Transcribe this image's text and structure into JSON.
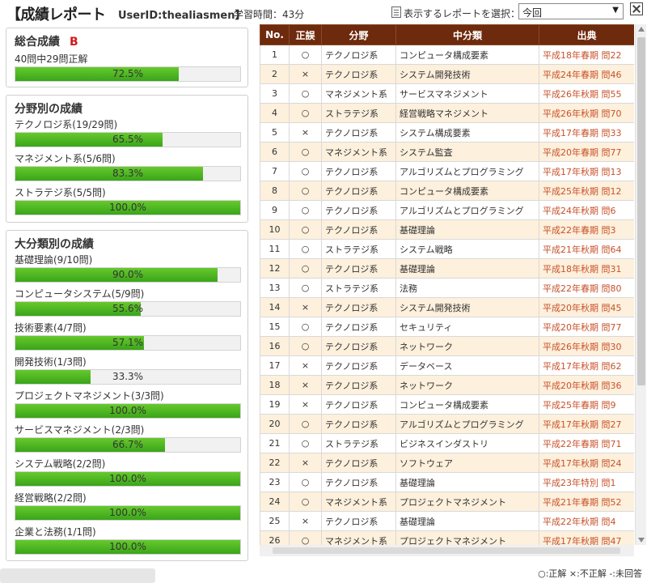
{
  "header": {
    "title": "【成績レポート",
    "userid": "UserID:thealiasmen】",
    "study_time": "学習時間：43分",
    "select_label": "表示するレポートを選択：",
    "select_value": "今回"
  },
  "overall": {
    "title": "総合成績",
    "grade": "B",
    "summary": "40問中29問正解",
    "pct_text": "72.5%",
    "pct": 72.5
  },
  "field": {
    "title": "分野別の成績",
    "items": [
      {
        "label": "テクノロジ系(19/29問)",
        "pct_text": "65.5%",
        "pct": 65.5
      },
      {
        "label": "マネジメント系(5/6問)",
        "pct_text": "83.3%",
        "pct": 83.3
      },
      {
        "label": "ストラテジ系(5/5問)",
        "pct_text": "100.0%",
        "pct": 100
      }
    ]
  },
  "category": {
    "title": "大分類別の成績",
    "items": [
      {
        "label": "基礎理論(9/10問)",
        "pct_text": "90.0%",
        "pct": 90
      },
      {
        "label": "コンピュータシステム(5/9問)",
        "pct_text": "55.6%",
        "pct": 55.6
      },
      {
        "label": "技術要素(4/7問)",
        "pct_text": "57.1%",
        "pct": 57.1
      },
      {
        "label": "開発技術(1/3問)",
        "pct_text": "33.3%",
        "pct": 33.3
      },
      {
        "label": "プロジェクトマネジメント(3/3問)",
        "pct_text": "100.0%",
        "pct": 100
      },
      {
        "label": "サービスマネジメント(2/3問)",
        "pct_text": "66.7%",
        "pct": 66.7
      },
      {
        "label": "システム戦略(2/2問)",
        "pct_text": "100.0%",
        "pct": 100
      },
      {
        "label": "経営戦略(2/2問)",
        "pct_text": "100.0%",
        "pct": 100
      },
      {
        "label": "企業と法務(1/1問)",
        "pct_text": "100.0%",
        "pct": 100
      }
    ]
  },
  "table": {
    "headers": [
      "No.",
      "正誤",
      "分野",
      "中分類",
      "出典"
    ],
    "rows": [
      [
        "1",
        "○",
        "テクノロジ系",
        "コンピュータ構成要素",
        "平成18年春期 問22"
      ],
      [
        "2",
        "×",
        "テクノロジ系",
        "システム開発技術",
        "平成24年春期 問46"
      ],
      [
        "3",
        "○",
        "マネジメント系",
        "サービスマネジメント",
        "平成26年秋期 問55"
      ],
      [
        "4",
        "○",
        "ストラテジ系",
        "経営戦略マネジメント",
        "平成26年秋期 問70"
      ],
      [
        "5",
        "×",
        "テクノロジ系",
        "システム構成要素",
        "平成17年春期 問33"
      ],
      [
        "6",
        "○",
        "マネジメント系",
        "システム監査",
        "平成20年春期 問77"
      ],
      [
        "7",
        "○",
        "テクノロジ系",
        "アルゴリズムとプログラミング",
        "平成17年秋期 問13"
      ],
      [
        "8",
        "○",
        "テクノロジ系",
        "コンピュータ構成要素",
        "平成25年秋期 問12"
      ],
      [
        "9",
        "○",
        "テクノロジ系",
        "アルゴリズムとプログラミング",
        "平成24年秋期 問6"
      ],
      [
        "10",
        "○",
        "テクノロジ系",
        "基礎理論",
        "平成22年春期 問3"
      ],
      [
        "11",
        "○",
        "ストラテジ系",
        "システム戦略",
        "平成21年秋期 問64"
      ],
      [
        "12",
        "○",
        "テクノロジ系",
        "基礎理論",
        "平成18年秋期 問31"
      ],
      [
        "13",
        "○",
        "ストラテジ系",
        "法務",
        "平成22年春期 問80"
      ],
      [
        "14",
        "×",
        "テクノロジ系",
        "システム開発技術",
        "平成20年秋期 問45"
      ],
      [
        "15",
        "○",
        "テクノロジ系",
        "セキュリティ",
        "平成20年秋期 問77"
      ],
      [
        "16",
        "○",
        "テクノロジ系",
        "ネットワーク",
        "平成26年秋期 問30"
      ],
      [
        "17",
        "×",
        "テクノロジ系",
        "データベース",
        "平成17年秋期 問62"
      ],
      [
        "18",
        "×",
        "テクノロジ系",
        "ネットワーク",
        "平成20年秋期 問36"
      ],
      [
        "19",
        "×",
        "テクノロジ系",
        "コンピュータ構成要素",
        "平成25年春期 問9"
      ],
      [
        "20",
        "○",
        "テクノロジ系",
        "アルゴリズムとプログラミング",
        "平成17年秋期 問27"
      ],
      [
        "21",
        "○",
        "ストラテジ系",
        "ビジネスインダストリ",
        "平成22年春期 問71"
      ],
      [
        "22",
        "×",
        "テクノロジ系",
        "ソフトウェア",
        "平成17年秋期 問24"
      ],
      [
        "23",
        "○",
        "テクノロジ系",
        "基礎理論",
        "平成23年特別 問1"
      ],
      [
        "24",
        "○",
        "マネジメント系",
        "プロジェクトマネジメント",
        "平成21年春期 問52"
      ],
      [
        "25",
        "×",
        "テクノロジ系",
        "基礎理論",
        "平成22年秋期 問4"
      ],
      [
        "26",
        "○",
        "マネジメント系",
        "プロジェクトマネジメント",
        "平成17年秋期 問47"
      ]
    ]
  },
  "legend": "○:正解 ×:不正解 -:未回答",
  "colors": {
    "header_bg": "#6e2a0d",
    "bar_fill": "#4db322",
    "grade": "#d21a1a",
    "source_text": "#c8512a",
    "row_alt": "#fdf0dc"
  }
}
